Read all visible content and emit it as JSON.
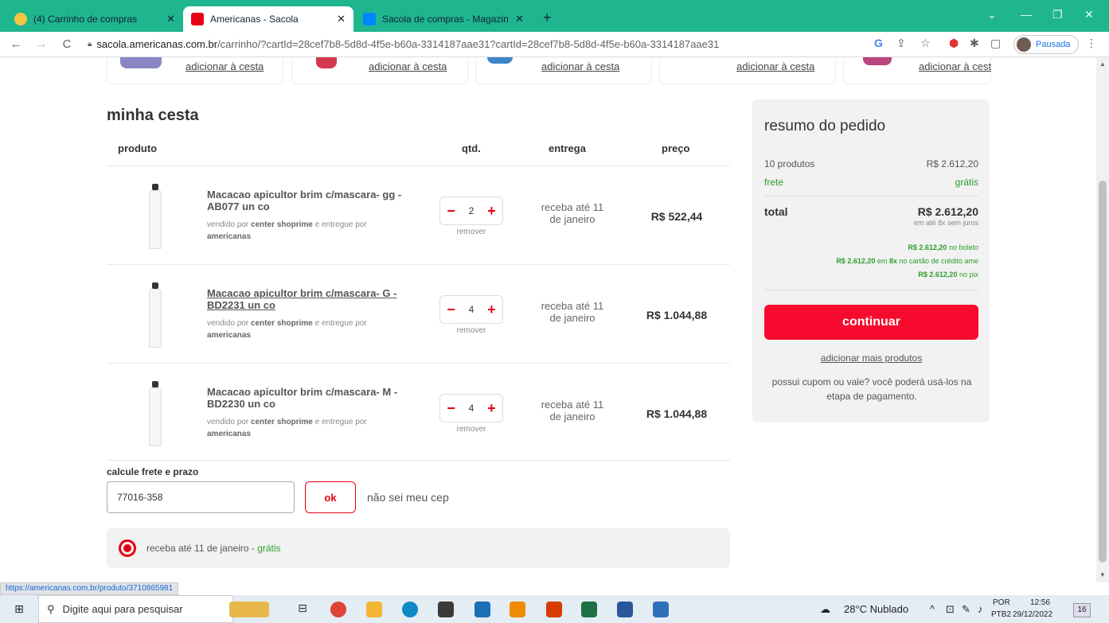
{
  "browser": {
    "tabs": [
      {
        "label": "(4) Carrinho de compras",
        "active": false,
        "icon": "cart-favicon"
      },
      {
        "label": "Americanas - Sacola",
        "active": true,
        "icon": "americanas-favicon"
      },
      {
        "label": "Sacola de compras - Magazine L",
        "active": false,
        "icon": "magalu-favicon"
      }
    ],
    "url_host": "sacola.americanas.com.br",
    "url_path": "/carrinho/?cartId=28cef7b8-5d8d-4f5e-b60a-3314187aae31?cartId=28cef7b8-5d8d-4f5e-b60a-3314187aae31",
    "profile_label": "Pausada"
  },
  "recommendations": [
    {
      "link": "adicionar à cesta"
    },
    {
      "link": "adicionar à cesta"
    },
    {
      "link": "adicionar à cesta"
    },
    {
      "link": "adicionar à cesta"
    },
    {
      "link": "adicionar à cest"
    }
  ],
  "cart": {
    "title": "minha cesta",
    "headers": {
      "product": "produto",
      "qty": "qtd.",
      "delivery": "entrega",
      "price": "preço"
    },
    "items": [
      {
        "name": "Macacao apicultor brim c/mascara- gg - AB077 un co",
        "sold_by_prefix": "vendido por",
        "seller": "center shoprime",
        "delivered_by_prefix": "e entregue por",
        "deliverer": "americanas",
        "qty": "2",
        "remove": "remover",
        "delivery": "receba até 11 de janeiro",
        "price": "R$ 522,44"
      },
      {
        "name": "Macacao apicultor brim c/mascara- G - BD2231 un co",
        "sold_by_prefix": "vendido por",
        "seller": "center shoprime",
        "delivered_by_prefix": "e entregue por",
        "deliverer": "americanas",
        "qty": "4",
        "remove": "remover",
        "delivery": "receba até 11 de janeiro",
        "price": "R$ 1.044,88"
      },
      {
        "name": "Macacao apicultor brim c/mascara- M - BD2230 un co",
        "sold_by_prefix": "vendido por",
        "seller": "center shoprime",
        "delivered_by_prefix": "e entregue por",
        "deliverer": "americanas",
        "qty": "4",
        "remove": "remover",
        "delivery": "receba até 11 de janeiro",
        "price": "R$ 1.044,88"
      }
    ],
    "shipping": {
      "label": "calcule frete e prazo",
      "cep_value": "77016-358",
      "ok_label": "ok",
      "dont_know": "não sei meu cep",
      "option_text": "receba até 11 de janeiro - ",
      "option_free": "grátis"
    }
  },
  "summary": {
    "title": "resumo do pedido",
    "products_label": "10 produtos",
    "products_value": "R$ 2.612,20",
    "freight_label": "frete",
    "freight_value": "grátis",
    "total_label": "total",
    "total_value": "R$ 2.612,20",
    "total_sub": "em até 8x sem juros",
    "boleto_value": "R$ 2.612,20",
    "boleto_suffix": "no boleto",
    "card_value": "R$ 2.612,20",
    "card_mid": "em",
    "card_installments": "8x",
    "card_suffix": "no cartão de crédito ame",
    "pix_value": "R$ 2.612,20",
    "pix_suffix": "no pix",
    "continue_label": "continuar",
    "add_more": "adicionar mais produtos",
    "coupon_text": "possui cupom ou vale? você poderá usá-los na etapa de pagamento.",
    "colors": {
      "accent": "#f60b2e",
      "green": "#2a9d2a"
    }
  },
  "status_link": "https://americanas.com.br/produto/3710865981",
  "taskbar": {
    "search_placeholder": "Digite aqui para pesquisar",
    "weather": "28°C Nublado",
    "lang_top": "POR",
    "lang_bottom": "PTB2",
    "time": "12:56",
    "date": "29/12/2022",
    "notif_count": "16"
  }
}
